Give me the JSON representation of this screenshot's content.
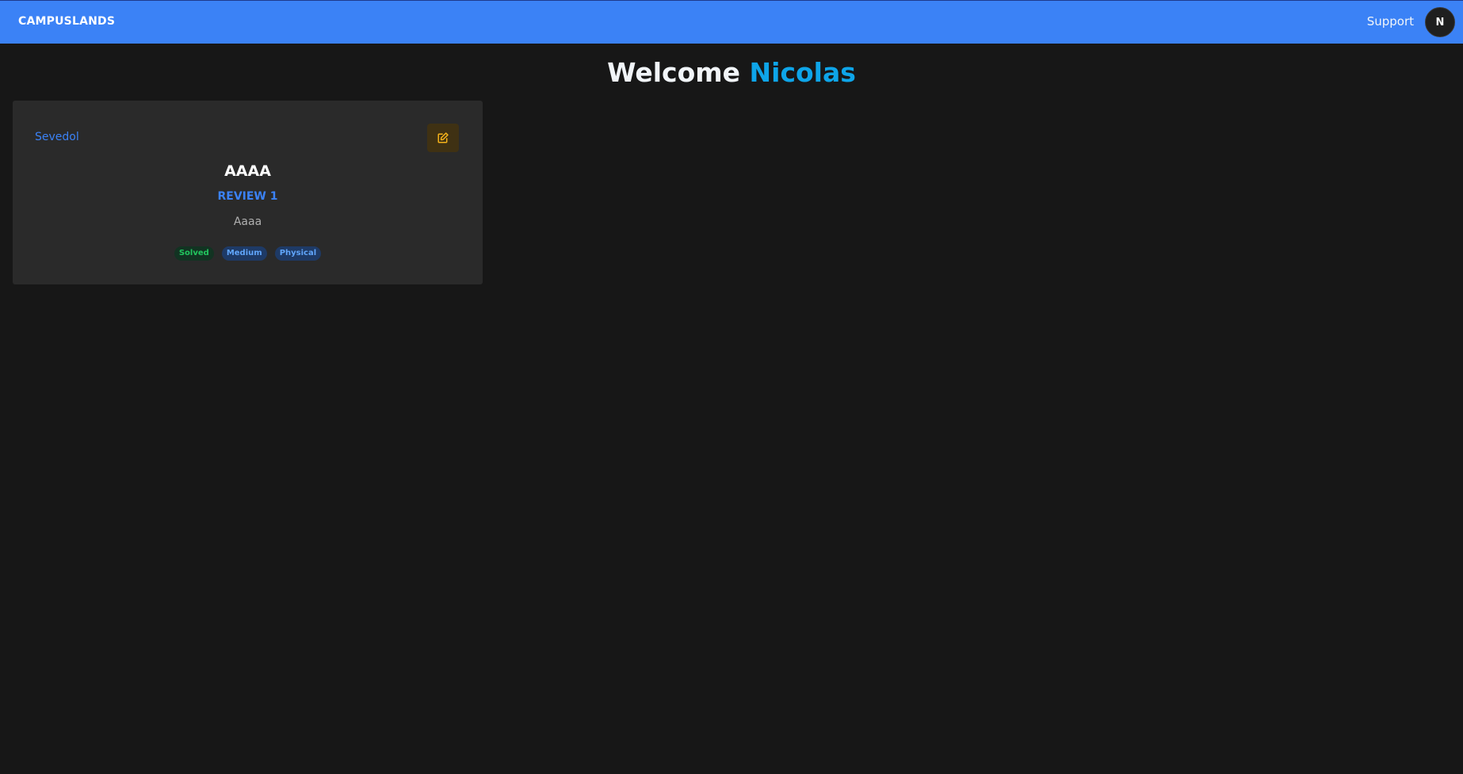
{
  "navbar": {
    "brand": "CAMPUSLANDS",
    "support_label": "Support",
    "avatar_initial": "N"
  },
  "welcome": {
    "greeting": "Welcome",
    "name": "Nicolas"
  },
  "card": {
    "author": "Sevedol",
    "title": "AAAA",
    "subtitle": "REVIEW 1",
    "description": "Aaaa",
    "tags": [
      {
        "label": "Solved",
        "kind": "status"
      },
      {
        "label": "Medium",
        "kind": "difficulty"
      },
      {
        "label": "Physical",
        "kind": "type"
      }
    ]
  },
  "colors": {
    "navbar_bg": "#3b82f6",
    "page_bg": "#171717",
    "card_bg": "#2a2a2a",
    "accent_name": "#0ea5e9",
    "edit_icon": "#f5b21a"
  },
  "icons": {
    "edit": "pencil-square-icon"
  }
}
